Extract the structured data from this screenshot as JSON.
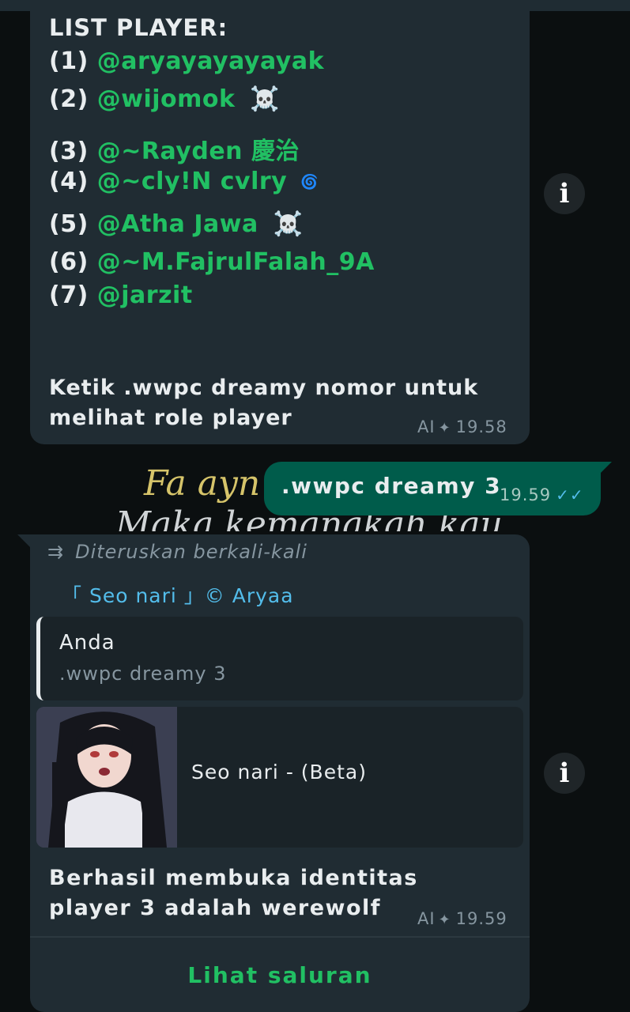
{
  "chat": {
    "message1": {
      "title": "LIST PLAYER:",
      "players": [
        {
          "num": "(1)",
          "mention": "@aryayayayayak",
          "suffix": ""
        },
        {
          "num": "(2)",
          "mention": "@wijomok",
          "suffix": "☠️"
        },
        {
          "num": "(3)",
          "mention": "@~Rayden 慶治",
          "suffix": ""
        },
        {
          "num": "(4)",
          "mention": "@~cly!N cvlry",
          "suffix": "🌀"
        },
        {
          "num": "(5)",
          "mention": "@Atha Jawa",
          "suffix": "☠️"
        },
        {
          "num": "(6)",
          "mention": "@~M.FajrulFalah_9A",
          "suffix": ""
        },
        {
          "num": "(7)",
          "mention": "@jarzit",
          "suffix": ""
        }
      ],
      "body": "Ketik .wwpc dreamy nomor untuk melihat role player",
      "ai_label": "AI",
      "time": "19.58"
    },
    "outgoing": {
      "text": ".wwpc dreamy 3",
      "time": "19.59"
    },
    "background_text": {
      "line1": "Fa ayn",
      "line2": "Maka kemanakah kau,"
    },
    "message2": {
      "forwarded_label": "Diteruskan berkali-kali",
      "sender": "「 Seo nari 」© Aryaa",
      "quote_author": "Anda",
      "quote_text": ".wwpc dreamy 3",
      "preview_title": "Seo nari - (Beta)",
      "body": "Berhasil membuka identitas player 3 adalah werewolf",
      "ai_label": "AI",
      "time": "19.59",
      "channel_button": "Lihat saluran"
    },
    "info_glyph": "i"
  },
  "colors": {
    "background": "#0b0f10",
    "incoming_bubble": "#202c33",
    "outgoing_bubble": "#005c4b",
    "mention_green": "#21c063",
    "sender_blue": "#53bdeb",
    "meta_gray": "#8696a0"
  },
  "icons": {
    "forward": "double-forward-arrow-icon",
    "ai": "ai-sparkle-icon",
    "read_receipt": "double-check-icon",
    "info": "info-icon"
  }
}
